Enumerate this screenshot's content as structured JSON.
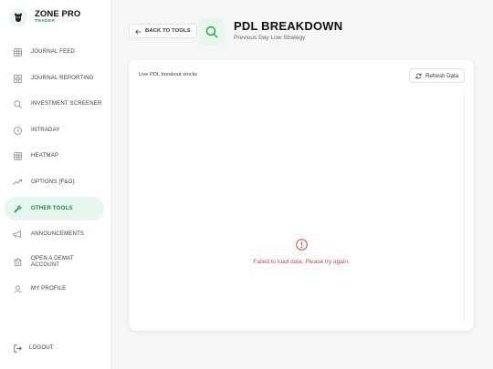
{
  "brand": {
    "name": "ZONE PRO",
    "sub": "TRADER"
  },
  "nav": {
    "items": [
      {
        "label": "JOURNAL FEED",
        "icon": "grid-icon"
      },
      {
        "label": "JOURNAL REPORTING",
        "icon": "dashboard-icon"
      },
      {
        "label": "INVESTMENT SCREENER",
        "icon": "search-icon"
      },
      {
        "label": "INTRADAY",
        "icon": "clock-icon"
      },
      {
        "label": "HEATMAP",
        "icon": "grid-icon"
      },
      {
        "label": "OPTIONS (F&O)",
        "icon": "trend-icon"
      },
      {
        "label": "OTHER TOOLS",
        "icon": "wrench-icon"
      },
      {
        "label": "ANNOUNCEMENTS",
        "icon": "megaphone-icon"
      },
      {
        "label": "OPEN A DEMAT ACCOUNT",
        "icon": "building-icon"
      },
      {
        "label": "MY PROFILE",
        "icon": "user-icon"
      }
    ],
    "active_index": 6,
    "logout": "LOGOUT"
  },
  "header": {
    "back_label": "BACK TO TOOLS",
    "title": "PDL BREAKDOWN",
    "subtitle": "Previous Day Low Strategy"
  },
  "card": {
    "title": "Live PDL breakout stocks",
    "refresh_label": "Refresh Data",
    "error": "Failed to load data. Please try again."
  },
  "colors": {
    "accent": "#22a04b",
    "accent_bg": "#e8f7ed",
    "error": "#d64545"
  }
}
